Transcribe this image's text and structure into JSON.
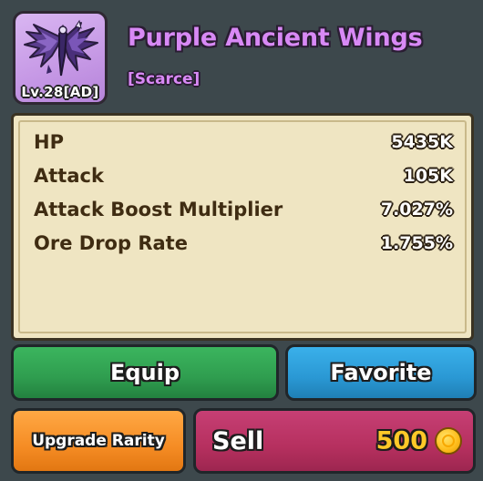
{
  "item": {
    "name": "Purple Ancient Wings",
    "rarity": "[Scarce]",
    "level_tag": "Lv.28[AD]",
    "icon": "purple-wings-icon"
  },
  "stats": [
    {
      "label": "HP",
      "value": "5435K"
    },
    {
      "label": "Attack",
      "value": "105K"
    },
    {
      "label": "Attack Boost Multiplier",
      "value": "7.027%"
    },
    {
      "label": "Ore Drop Rate",
      "value": "1.755%"
    }
  ],
  "actions": {
    "equip_label": "Equip",
    "favorite_label": "Favorite",
    "upgrade_label": "Upgrade Rarity",
    "sell_label": "Sell",
    "sell_price": "500",
    "currency_icon": "gold-coin-icon"
  },
  "colors": {
    "title": "#d889f5",
    "equip": "#2f9d4f",
    "favorite": "#2a98d4",
    "upgrade": "#f58c24",
    "sell": "#b6305f",
    "price": "#ffc928"
  }
}
